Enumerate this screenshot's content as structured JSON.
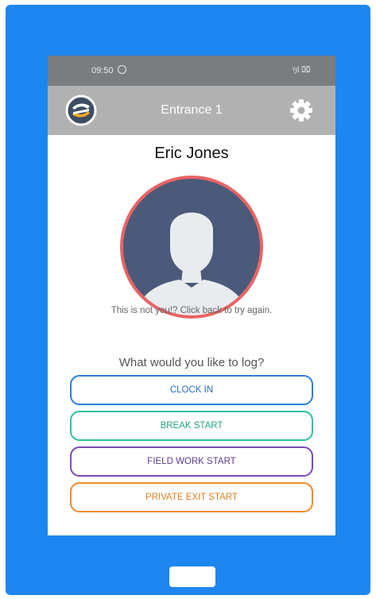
{
  "statusbar": {
    "time": "09:50",
    "signal": "ᵞ͈ıl ⌧"
  },
  "appbar": {
    "title": "Entrance 1"
  },
  "user": {
    "name": "Eric Jones"
  },
  "hint": "This is not you!? Click back to try again.",
  "prompt": "What would you like to log?",
  "actions": [
    {
      "label": "CLOCK IN"
    },
    {
      "label": "BREAK START"
    },
    {
      "label": "FIELD WORK START"
    },
    {
      "label": "PRIVATE EXIT START"
    }
  ],
  "colors": {
    "device": "#1e86f0",
    "clock_in": "#2b7fd8",
    "break": "#2fc1a0",
    "field": "#7b4ab8",
    "private": "#f08a2a",
    "avatar_ring": "#e86464",
    "avatar_bg": "#4b5a7a"
  },
  "icons": {
    "logo": "app-logo-icon",
    "settings": "gear-icon",
    "avatar": "person-silhouette-icon",
    "status": "whatsapp-icon"
  }
}
